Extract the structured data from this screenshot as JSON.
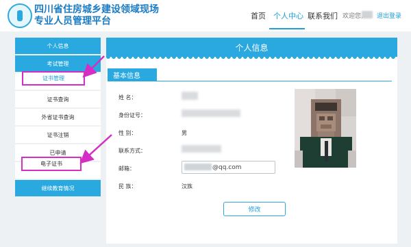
{
  "header": {
    "site_title_line1": "四川省住房城乡建设领域现场",
    "site_title_line2": "专业人员管理平台",
    "nav": {
      "home": "首页",
      "personal_center": "个人中心",
      "contact": "联系我们"
    },
    "welcome": "欢迎您,",
    "logout": "退出登录"
  },
  "sidebar": {
    "items": [
      {
        "label": "个人信息",
        "style": "blue"
      },
      {
        "label": "考试管理",
        "style": "blue"
      },
      {
        "label": "证书管理",
        "style": "active"
      },
      {
        "label": "证书查询",
        "style": "white"
      },
      {
        "label": "外省证书查询",
        "style": "white"
      },
      {
        "label": "证书注销",
        "style": "white"
      },
      {
        "label": "已申请",
        "style": "white"
      },
      {
        "label": "电子证书",
        "style": "highlight"
      },
      {
        "label": "继续教育情况",
        "style": "blue"
      }
    ]
  },
  "main": {
    "title": "个人信息",
    "section": "基本信息",
    "fields": {
      "name_label": "姓    名：",
      "id_label": "身份证号：",
      "gender_label": "性    别：",
      "gender_value": "男",
      "contact_label": "联系方式：",
      "email_label": "邮箱：",
      "email_value": "@qq.com",
      "ethnicity_label": "民    族：",
      "ethnicity_value": "汉族"
    },
    "edit_button": "修改"
  },
  "colors": {
    "accent": "#2aa8e0",
    "highlight": "#d42ec4"
  },
  "icons": [
    "logo-icon",
    "photo"
  ]
}
